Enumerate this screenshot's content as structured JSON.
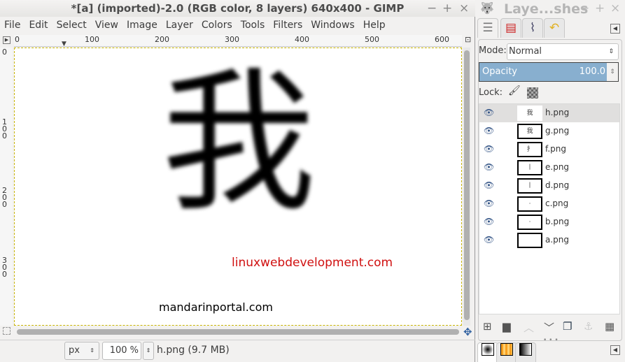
{
  "window": {
    "title": "*[a] (imported)-2.0 (RGB color, 8 layers) 640x400 - GIMP",
    "controls": [
      "−",
      "+",
      "×"
    ]
  },
  "menu": [
    "File",
    "Edit",
    "Select",
    "View",
    "Image",
    "Layer",
    "Colors",
    "Tools",
    "Filters",
    "Windows",
    "Help"
  ],
  "hruler": [
    "0",
    "100",
    "200",
    "300",
    "400",
    "500",
    "600"
  ],
  "vruler": [
    "0",
    "100",
    "200",
    "300"
  ],
  "canvas": {
    "glyph": "我",
    "watermark_red": "linuxwebdevelopment.com",
    "watermark_black": "mandarinportal.com",
    "accent_red": "#d01010"
  },
  "status": {
    "unit": "px",
    "zoom": "100 %",
    "info": "h.png (9.7 MB)"
  },
  "dock": {
    "title": "Laye...shes",
    "controls": [
      "−",
      "+",
      "×"
    ],
    "tabs": [
      "layers-icon",
      "channels-icon",
      "paths-icon",
      "undo-history-icon"
    ],
    "mode_label": "Mode:",
    "mode_value": "Normal",
    "opacity_label": "Opacity",
    "opacity_value": "100.0",
    "lock_label": "Lock:",
    "layers": [
      {
        "name": "h.png",
        "selected": true
      },
      {
        "name": "g.png"
      },
      {
        "name": "f.png"
      },
      {
        "name": "e.png"
      },
      {
        "name": "d.png"
      },
      {
        "name": "c.png"
      },
      {
        "name": "b.png"
      },
      {
        "name": "a.png"
      }
    ],
    "bottom_buttons": [
      "new-layer",
      "new-group",
      "raise-layer",
      "lower-layer",
      "duplicate-layer",
      "anchor-layer",
      "delete-layer"
    ],
    "bottom_tabs": [
      "brushes-icon",
      "patterns-icon",
      "gradients-icon"
    ],
    "highlight": "#88afcf"
  }
}
